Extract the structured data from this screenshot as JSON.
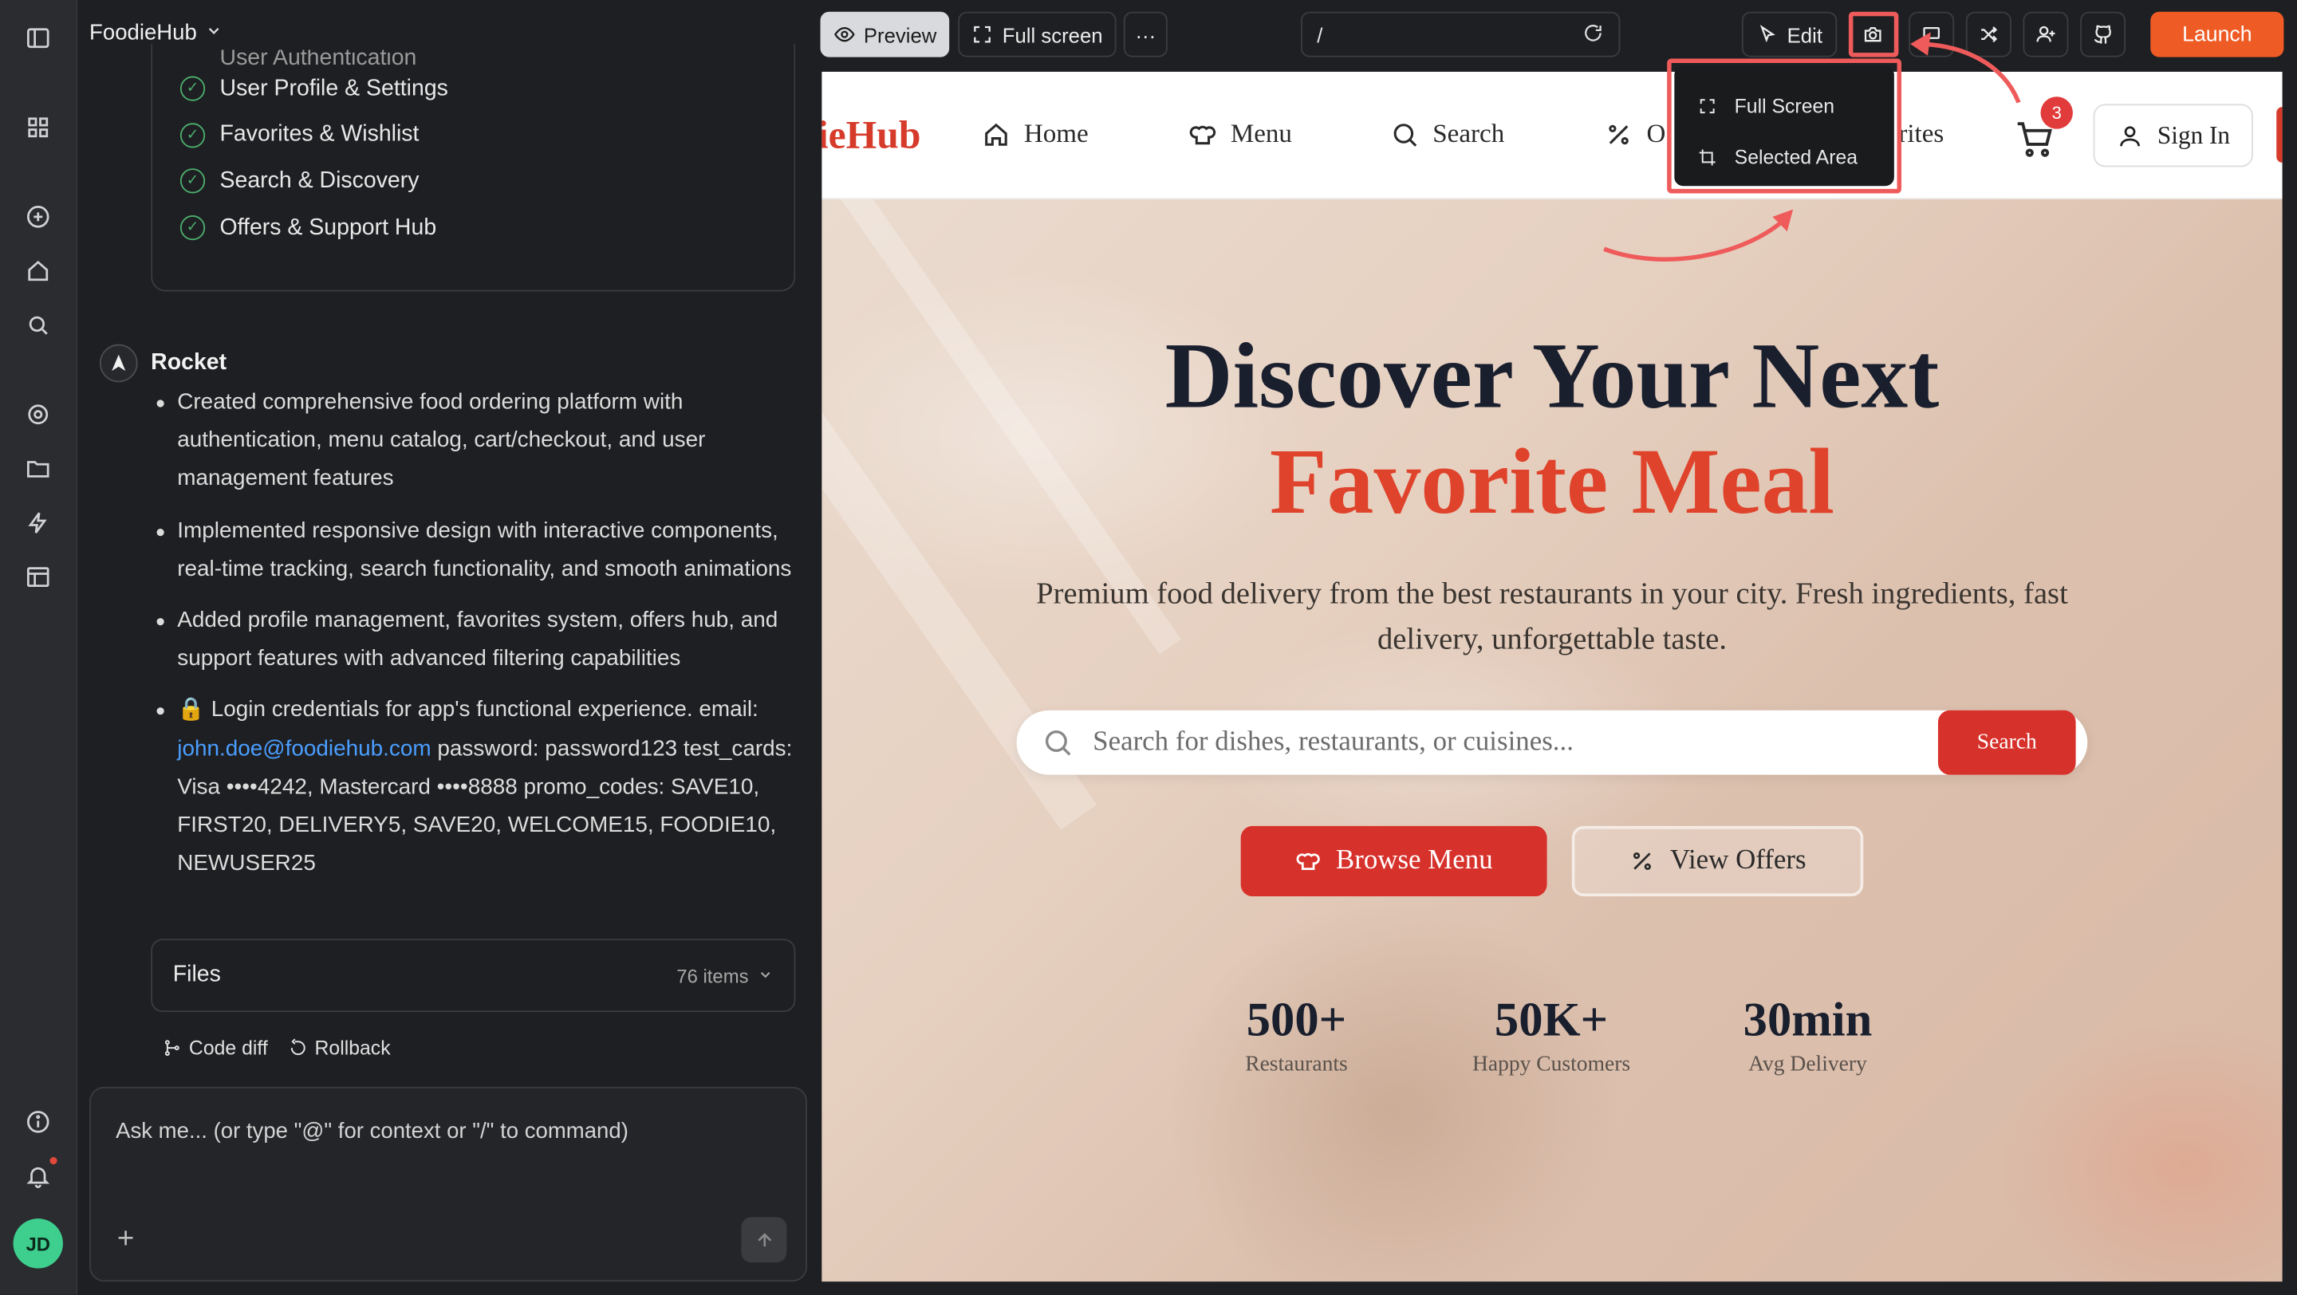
{
  "project": {
    "name": "FoodieHub"
  },
  "checklist": {
    "cut_item": "User Authentication",
    "items": [
      "User Profile & Settings",
      "Favorites & Wishlist",
      "Search & Discovery",
      "Offers & Support Hub"
    ]
  },
  "assistant": {
    "name": "Rocket",
    "bullets": [
      "Created comprehensive food ordering platform with authentication, menu catalog, cart/checkout, and user management features",
      "Implemented responsive design with interactive components, real-time tracking, search functionality, and smooth animations",
      "Added profile management, favorites system, offers hub, and support features with advanced filtering capabilities"
    ],
    "credentials": {
      "prefix": "🔒 Login credentials for app's functional experience. email: ",
      "email": "john.doe@foodiehub.com",
      "rest": " password: password123 test_cards: Visa ••••4242, Mastercard ••••8888 promo_codes: SAVE10, FIRST20, DELIVERY5, SAVE20, WELCOME15, FOODIE10, NEWUSER25"
    }
  },
  "files": {
    "label": "Files",
    "count": "76 items"
  },
  "actions": {
    "code_diff": "Code diff",
    "rollback": "Rollback"
  },
  "composer": {
    "placeholder": "Ask me... (or type \"@\" for context or \"/\" to command)"
  },
  "toolbar": {
    "preview": "Preview",
    "fullscreen": "Full screen",
    "more": "···",
    "url": "/",
    "edit": "Edit",
    "launch": "Launch"
  },
  "screenshot_menu": {
    "items": [
      "Full Screen",
      "Selected Area"
    ]
  },
  "site": {
    "logo": "ieHub",
    "nav": [
      {
        "label": "Home",
        "icon": "home-icon"
      },
      {
        "label": "Menu",
        "icon": "chef-hat-icon"
      },
      {
        "label": "Search",
        "icon": "search-icon"
      },
      {
        "label": "O",
        "icon": "percent-icon"
      }
    ],
    "nav_partial": "rites",
    "cart_count": "3",
    "signin": "Sign In",
    "hero": {
      "title_line1": "Discover Your Next",
      "title_line2": "Favorite Meal",
      "subtitle": "Premium food delivery from the best restaurants in your city. Fresh ingredients, fast delivery, unforgettable taste.",
      "search_placeholder": "Search for dishes, restaurants, or cuisines...",
      "search_button": "Search",
      "browse_button": "Browse Menu",
      "offers_button": "View Offers",
      "stats": [
        {
          "value": "500+",
          "label": "Restaurants"
        },
        {
          "value": "50K+",
          "label": "Happy Customers"
        },
        {
          "value": "30min",
          "label": "Avg Delivery"
        }
      ]
    }
  },
  "colors": {
    "accent": "#ef5b25",
    "brand_red": "#d7312b",
    "highlight": "#ef5b5b",
    "check_green": "#4caf6e",
    "link": "#4a9eff"
  },
  "avatar": {
    "initials": "JD"
  }
}
